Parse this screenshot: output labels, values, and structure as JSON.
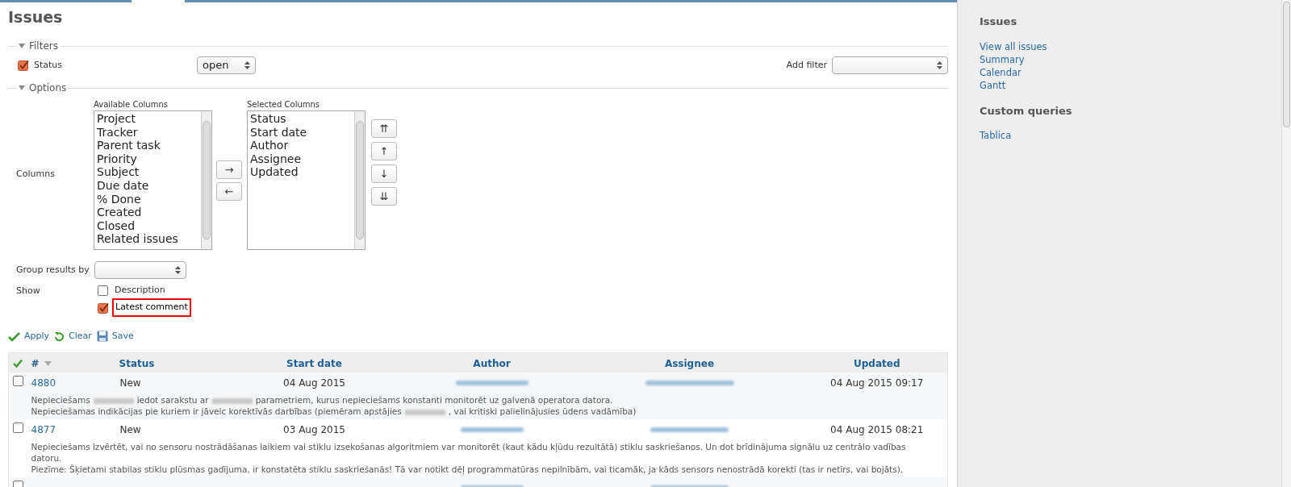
{
  "title": "Issues",
  "filters": {
    "legend": "Filters",
    "expanded": true,
    "status": {
      "label": "Status",
      "checked": true,
      "value": "open"
    },
    "add_filter": {
      "label": "Add filter"
    }
  },
  "options": {
    "legend": "Options",
    "expanded": true,
    "columns_label": "Columns",
    "available": {
      "label": "Available Columns",
      "items": [
        "Project",
        "Tracker",
        "Parent task",
        "Priority",
        "Subject",
        "Due date",
        "% Done",
        "Created",
        "Closed",
        "Related issues"
      ]
    },
    "selected": {
      "label": "Selected Columns",
      "items": [
        "Status",
        "Start date",
        "Author",
        "Assignee",
        "Updated"
      ]
    },
    "move_buttons": [
      "→",
      "←"
    ],
    "order_buttons": [
      "⇈",
      "↑",
      "↓",
      "⇊"
    ],
    "group_label": "Group results by",
    "show_label": "Show",
    "show_options": [
      {
        "label": "Description",
        "checked": false,
        "highlighted": false
      },
      {
        "label": "Latest comment",
        "checked": true,
        "highlighted": true
      }
    ]
  },
  "actions": [
    {
      "kind": "apply",
      "label": "Apply"
    },
    {
      "kind": "clear",
      "label": "Clear"
    },
    {
      "kind": "save",
      "label": "Save"
    }
  ],
  "table": {
    "columns": [
      "#",
      "Status",
      "Start date",
      "Author",
      "Assignee",
      "Updated"
    ],
    "rows": [
      {
        "id": "4880",
        "checked": false,
        "status": "New",
        "start": "04 Aug 2015",
        "updated": "04 Aug 2015 09:17",
        "comment": [
          [
            {
              "kind": "text",
              "text": "Nepieciešams"
            },
            {
              "kind": "redacted"
            },
            {
              "kind": "text",
              "text": "iedot sarakstu ar"
            },
            {
              "kind": "redacted"
            },
            {
              "kind": "text",
              "text": "parametriem, kurus nepieciešams konstanti monitorēt uz galvenā operatora datora."
            }
          ],
          [
            {
              "kind": "text",
              "text": "Nepieciešamas indikācijas pie kuriem ir jāveic korektīvās darbības (piemēram apstājies"
            },
            {
              "kind": "redacted"
            },
            {
              "kind": "text",
              "text": ", vai kritiski palielinājusies ūdens vadāmība)"
            }
          ]
        ]
      },
      {
        "id": "4877",
        "checked": false,
        "status": "New",
        "start": "03 Aug 2015",
        "updated": "04 Aug 2015 08:21",
        "comment": [
          [
            {
              "kind": "text",
              "text": "Nepieciešams izvērtēt, vai no sensoru nostrādāšanas laikiem vai stiklu izsekošanas algoritmiem var monitorēt (kaut kādu kļūdu rezultātā) stiklu saskriešanos. Un dot brīdinājuma signālu uz centrālo vadības datoru."
            }
          ],
          [
            {
              "kind": "text",
              "text": "Piezīme: Šķietami stabilas stiklu plūsmas gadījuma, ir konstatēta stiklu saskriešanās! Tā var notikt dēļ programmatūras nepilnībām, vai ticamāk, ja kāds sensors nenostrādā korekti (tas ir netīrs, vai bojāts)."
            }
          ]
        ]
      },
      {
        "checked": false,
        "comment": []
      }
    ]
  },
  "sidebar": {
    "sections": [
      {
        "title": "Issues",
        "links": [
          "View all issues",
          "Summary",
          "Calendar",
          "Gantt"
        ]
      },
      {
        "title": "Custom queries",
        "links": [
          "Tablica"
        ]
      }
    ]
  }
}
